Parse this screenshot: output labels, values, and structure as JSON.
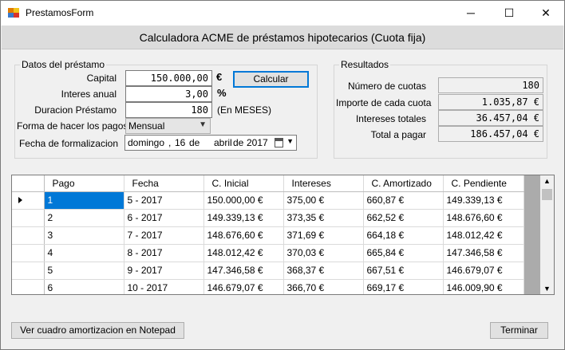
{
  "window": {
    "title": "PrestamosForm",
    "controls": {
      "minimize": "─",
      "maximize": "☐",
      "close": "✕"
    }
  },
  "header": {
    "title": "Calculadora ACME de préstamos hipotecarios (Cuota fija)"
  },
  "datos": {
    "group_label": "Datos del préstamo",
    "capital": {
      "label": "Capital",
      "value": "150.000,00",
      "unit": "€"
    },
    "interes": {
      "label": "Interes anual",
      "value": "3,00",
      "unit": "%"
    },
    "duracion": {
      "label": "Duracion Préstamo",
      "value": "180",
      "unit": "(En MESES)"
    },
    "forma": {
      "label": "Forma de hacer los pagos",
      "selected": "Mensual"
    },
    "fecha": {
      "label": "Fecha de formalizacion",
      "weekday": "domingo",
      "day": "16",
      "de1": "de",
      "month": "abril",
      "de2": "de",
      "year": "2017"
    },
    "calcular_label": "Calcular"
  },
  "resultados": {
    "group_label": "Resultados",
    "num_cuotas": {
      "label": "Número de cuotas",
      "value": "180"
    },
    "importe": {
      "label": "Importe de cada cuota",
      "value": "1.035,87 €"
    },
    "intereses": {
      "label": "Intereses totales",
      "value": "36.457,04 €"
    },
    "total": {
      "label": "Total a pagar",
      "value": "186.457,04 €"
    }
  },
  "table": {
    "columns": [
      "Pago",
      "Fecha",
      "C. Inicial",
      "Intereses",
      "C. Amortizado",
      "C. Pendiente"
    ],
    "rows": [
      [
        "1",
        "5 - 2017",
        "150.000,00 €",
        "375,00 €",
        "660,87 €",
        "149.339,13 €"
      ],
      [
        "2",
        "6 - 2017",
        "149.339,13 €",
        "373,35 €",
        "662,52 €",
        "148.676,60 €"
      ],
      [
        "3",
        "7 - 2017",
        "148.676,60 €",
        "371,69 €",
        "664,18 €",
        "148.012,42 €"
      ],
      [
        "4",
        "8 - 2017",
        "148.012,42 €",
        "370,03 €",
        "665,84 €",
        "147.346,58 €"
      ],
      [
        "5",
        "9 - 2017",
        "147.346,58 €",
        "368,37 €",
        "667,51 €",
        "146.679,07 €"
      ],
      [
        "6",
        "10 - 2017",
        "146.679,07 €",
        "366,70 €",
        "669,17 €",
        "146.009,90 €"
      ]
    ]
  },
  "footer": {
    "notepad_label": "Ver cuadro amortizacion en Notepad",
    "terminar_label": "Terminar"
  },
  "colors": {
    "selection": "#0078d7",
    "focus_border": "#0078d7"
  }
}
